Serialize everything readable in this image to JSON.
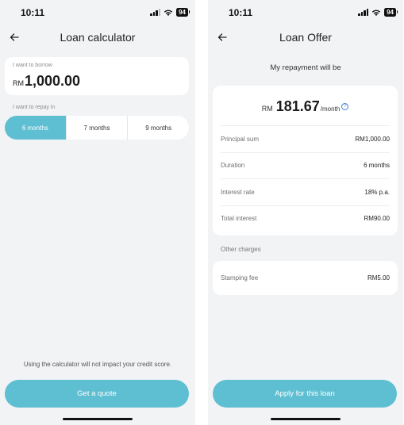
{
  "status_bar": {
    "time": "10:11",
    "battery": "94"
  },
  "calculator": {
    "title": "Loan calculator",
    "borrow_label": "I want to borrow",
    "borrow_currency": "RM",
    "borrow_amount": "1,000.00",
    "repay_label": "I want to repay in",
    "durations": [
      {
        "label": "6 months",
        "selected": true
      },
      {
        "label": "7 months",
        "selected": false
      },
      {
        "label": "9 months",
        "selected": false
      }
    ],
    "disclaimer": "Using the calculator will not impact your credit score.",
    "cta": "Get a quote"
  },
  "offer": {
    "title": "Loan Offer",
    "subtitle": "My repayment will be",
    "currency": "RM",
    "monthly_amount": "181.67",
    "monthly_unit": "/month",
    "help_glyph": "?",
    "details": [
      {
        "label": "Principal sum",
        "value": "RM1,000.00"
      },
      {
        "label": "Duration",
        "value": "6 months"
      },
      {
        "label": "Interest rate",
        "value": "18% p.a."
      },
      {
        "label": "Total interest",
        "value": "RM90.00"
      }
    ],
    "other_charges_label": "Other charges",
    "stamping_fee_label": "Stamping fee",
    "stamping_fee_value": "RM5.00",
    "cta": "Apply for this loan"
  },
  "colors": {
    "accent": "#5ebfd2",
    "background": "#f2f3f5",
    "info_blue": "#3a7fd1"
  },
  "icons": [
    "signal-icon",
    "wifi-icon",
    "battery-icon",
    "back-arrow-icon",
    "help-circle-icon"
  ]
}
